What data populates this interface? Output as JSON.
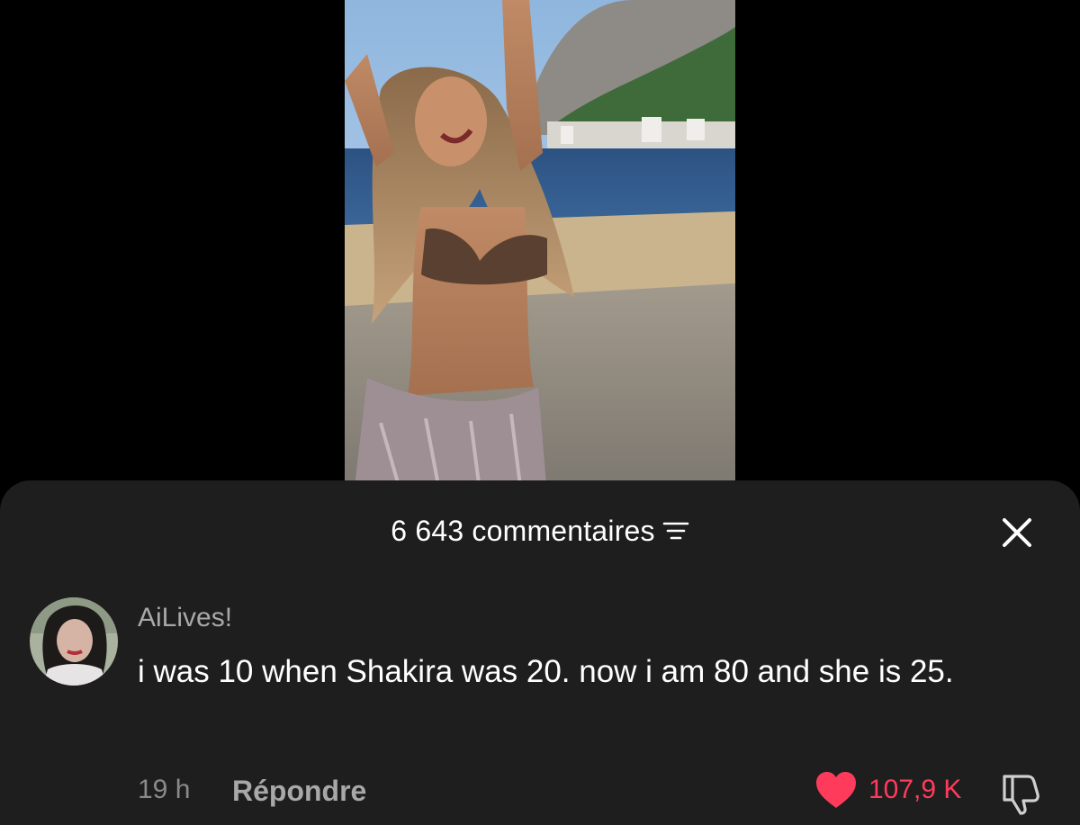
{
  "comments_panel": {
    "count_label": "6 643 commentaires",
    "sort_icon": "sort-lines-icon",
    "close_icon": "close-x-icon"
  },
  "comment": {
    "username": "AiLives!",
    "text": "i was 10 when Shakira was 20. now i am 80 and she is 25.",
    "timestamp": "19 h",
    "reply_label": "Répondre",
    "like_count": "107,9 K",
    "liked": true,
    "heart_icon": "heart-icon",
    "dislike_icon": "thumbs-down-icon"
  },
  "colors": {
    "background": "#000000",
    "sheet": "#1e1e1e",
    "like_red": "#ff3b5c",
    "muted_text": "#a8a8a8"
  }
}
